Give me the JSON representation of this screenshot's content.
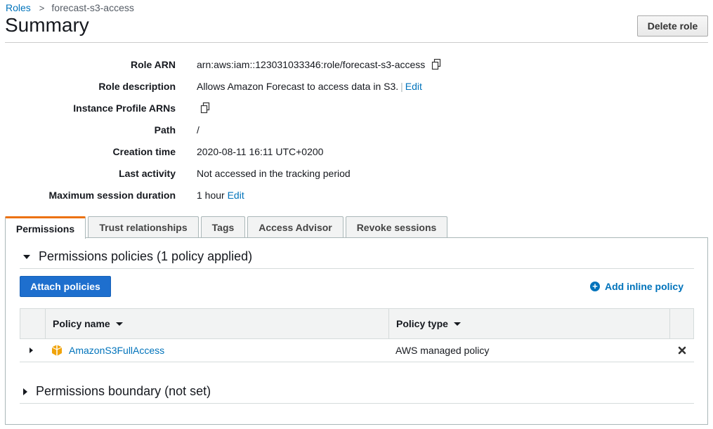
{
  "breadcrumb": {
    "parent": "Roles",
    "current": "forecast-s3-access"
  },
  "page_title": "Summary",
  "delete_label": "Delete role",
  "summary": {
    "role_arn": {
      "label": "Role ARN",
      "value": "arn:aws:iam::123031033346:role/forecast-s3-access"
    },
    "role_description": {
      "label": "Role description",
      "value": "Allows Amazon Forecast to access data in S3.",
      "pipe": "|",
      "edit": "Edit"
    },
    "instance_profile": {
      "label": "Instance Profile ARNs"
    },
    "path": {
      "label": "Path",
      "value": "/"
    },
    "creation_time": {
      "label": "Creation time",
      "value": "2020-08-11 16:11 UTC+0200"
    },
    "last_activity": {
      "label": "Last activity",
      "value": "Not accessed in the tracking period"
    },
    "max_session": {
      "label": "Maximum session duration",
      "value": "1 hour",
      "edit": "Edit"
    }
  },
  "tabs": [
    "Permissions",
    "Trust relationships",
    "Tags",
    "Access Advisor",
    "Revoke sessions"
  ],
  "permissions": {
    "policies_heading": "Permissions policies (1 policy applied)",
    "attach_label": "Attach policies",
    "add_inline_label": "Add inline policy",
    "table": {
      "columns": [
        "Policy name",
        "Policy type"
      ],
      "rows": [
        {
          "name": "AmazonS3FullAccess",
          "type": "AWS managed policy"
        }
      ]
    },
    "boundary_heading": "Permissions boundary (not set)"
  },
  "colors": {
    "accent_tab": "#ec7211",
    "primary_button": "#1e6fce",
    "link": "#0073bb",
    "policy_icon": "#f0a30a"
  }
}
